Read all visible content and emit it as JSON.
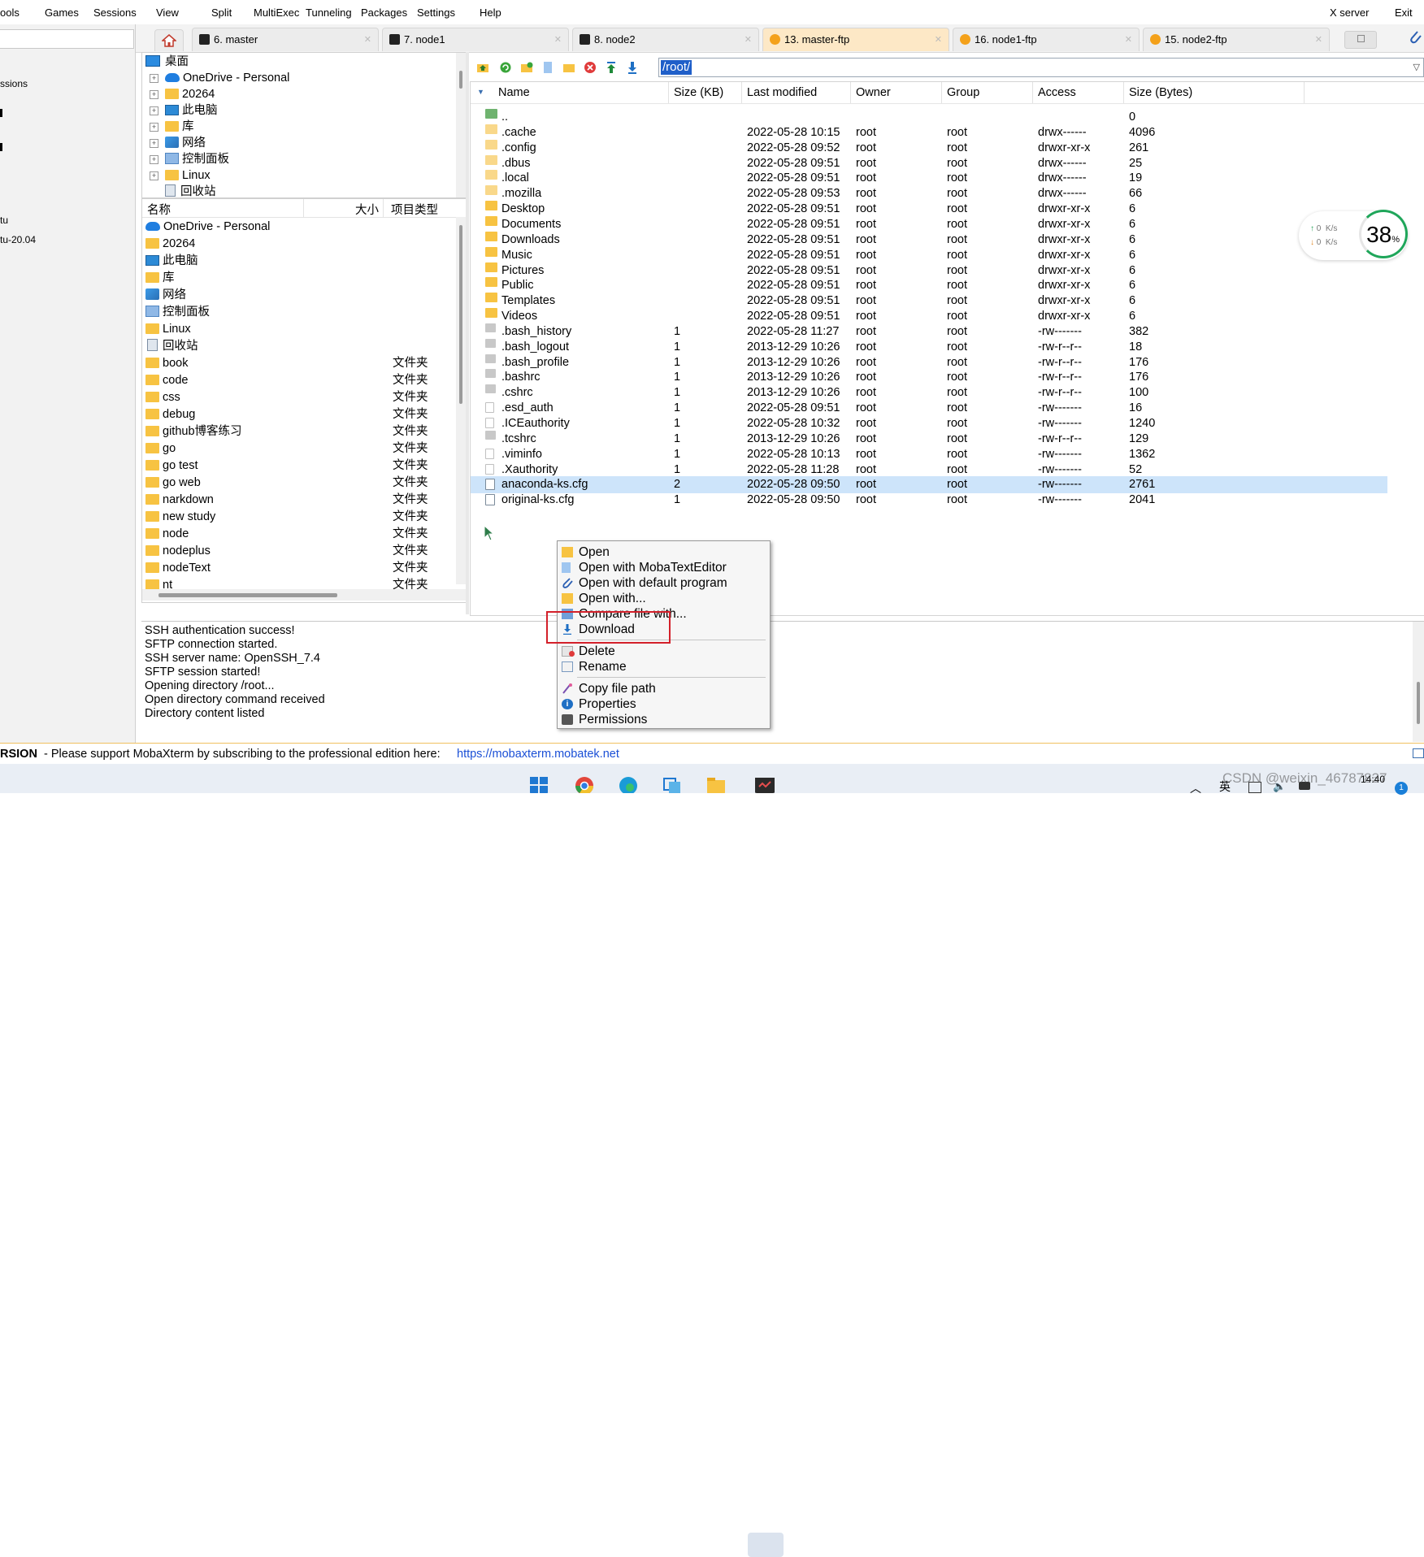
{
  "menubar": {
    "items": [
      "ools",
      "Games",
      "Sessions",
      "View",
      "Split",
      "MultiExec",
      "Tunneling",
      "Packages",
      "Settings",
      "Help"
    ],
    "xserver": "X server",
    "exit": "Exit"
  },
  "tabs": [
    {
      "label": "6. master",
      "kind": "terminal"
    },
    {
      "label": "7. node1",
      "kind": "terminal"
    },
    {
      "label": "8. node2",
      "kind": "terminal"
    },
    {
      "label": "13. master-ftp",
      "kind": "ftp",
      "active": true
    },
    {
      "label": "16. node1-ftp",
      "kind": "ftp"
    },
    {
      "label": "15. node2-ftp",
      "kind": "ftp"
    }
  ],
  "leftstrip": {
    "lines": [
      "ssions",
      "tu",
      "tu-20.04"
    ]
  },
  "local_tree": {
    "root": "桌面",
    "items": [
      "OneDrive - Personal",
      "20264",
      "此电脑",
      "库",
      "网络",
      "控制面板",
      "Linux",
      "回收站"
    ]
  },
  "local_list": {
    "headers": {
      "name": "名称",
      "size": "大小",
      "type": "项目类型"
    },
    "rows": [
      {
        "name": "OneDrive - Personal",
        "type": "",
        "icon": "onedrive-icon"
      },
      {
        "name": "20264",
        "type": "",
        "icon": "folder-icon"
      },
      {
        "name": "此电脑",
        "type": "",
        "icon": "computer-icon"
      },
      {
        "name": "库",
        "type": "",
        "icon": "folder-icon"
      },
      {
        "name": "网络",
        "type": "",
        "icon": "network-icon"
      },
      {
        "name": "控制面板",
        "type": "",
        "icon": "control-panel-icon"
      },
      {
        "name": "Linux",
        "type": "",
        "icon": "folder-icon"
      },
      {
        "name": "回收站",
        "type": "",
        "icon": "recycle-bin-icon"
      },
      {
        "name": "book",
        "type": "文件夹",
        "icon": "folder-icon"
      },
      {
        "name": "code",
        "type": "文件夹",
        "icon": "folder-icon"
      },
      {
        "name": "css",
        "type": "文件夹",
        "icon": "folder-icon"
      },
      {
        "name": "debug",
        "type": "文件夹",
        "icon": "folder-icon"
      },
      {
        "name": "github博客练习",
        "type": "文件夹",
        "icon": "folder-icon"
      },
      {
        "name": "go",
        "type": "文件夹",
        "icon": "folder-icon"
      },
      {
        "name": "go test",
        "type": "文件夹",
        "icon": "folder-icon"
      },
      {
        "name": "go web",
        "type": "文件夹",
        "icon": "folder-icon"
      },
      {
        "name": "narkdown",
        "type": "文件夹",
        "icon": "folder-icon"
      },
      {
        "name": "new study",
        "type": "文件夹",
        "icon": "folder-icon"
      },
      {
        "name": "node",
        "type": "文件夹",
        "icon": "folder-icon"
      },
      {
        "name": "nodeplus",
        "type": "文件夹",
        "icon": "folder-icon"
      },
      {
        "name": "nodeText",
        "type": "文件夹",
        "icon": "folder-icon"
      },
      {
        "name": "nt",
        "type": "文件夹",
        "icon": "folder-icon"
      }
    ]
  },
  "remote": {
    "path": "/root/",
    "headers": {
      "name": "Name",
      "size_kb": "Size (KB)",
      "modified": "Last modified",
      "owner": "Owner",
      "group": "Group",
      "access": "Access",
      "size_bytes": "Size (Bytes)"
    },
    "rows": [
      {
        "name": "..",
        "size_kb": "",
        "modified": "",
        "owner": "",
        "group": "",
        "access": "",
        "size_bytes": "0",
        "icon": "parent-dir-icon"
      },
      {
        "name": ".cache",
        "size_kb": "",
        "modified": "2022-05-28 10:15",
        "owner": "root",
        "group": "root",
        "access": "drwx------",
        "size_bytes": "4096",
        "icon": "hidden-folder-icon"
      },
      {
        "name": ".config",
        "size_kb": "",
        "modified": "2022-05-28 09:52",
        "owner": "root",
        "group": "root",
        "access": "drwxr-xr-x",
        "size_bytes": "261",
        "icon": "hidden-folder-icon"
      },
      {
        "name": ".dbus",
        "size_kb": "",
        "modified": "2022-05-28 09:51",
        "owner": "root",
        "group": "root",
        "access": "drwx------",
        "size_bytes": "25",
        "icon": "hidden-folder-icon"
      },
      {
        "name": ".local",
        "size_kb": "",
        "modified": "2022-05-28 09:51",
        "owner": "root",
        "group": "root",
        "access": "drwx------",
        "size_bytes": "19",
        "icon": "hidden-folder-icon"
      },
      {
        "name": ".mozilla",
        "size_kb": "",
        "modified": "2022-05-28 09:53",
        "owner": "root",
        "group": "root",
        "access": "drwx------",
        "size_bytes": "66",
        "icon": "hidden-folder-icon"
      },
      {
        "name": "Desktop",
        "size_kb": "",
        "modified": "2022-05-28 09:51",
        "owner": "root",
        "group": "root",
        "access": "drwxr-xr-x",
        "size_bytes": "6",
        "icon": "folder-icon"
      },
      {
        "name": "Documents",
        "size_kb": "",
        "modified": "2022-05-28 09:51",
        "owner": "root",
        "group": "root",
        "access": "drwxr-xr-x",
        "size_bytes": "6",
        "icon": "folder-icon"
      },
      {
        "name": "Downloads",
        "size_kb": "",
        "modified": "2022-05-28 09:51",
        "owner": "root",
        "group": "root",
        "access": "drwxr-xr-x",
        "size_bytes": "6",
        "icon": "folder-icon"
      },
      {
        "name": "Music",
        "size_kb": "",
        "modified": "2022-05-28 09:51",
        "owner": "root",
        "group": "root",
        "access": "drwxr-xr-x",
        "size_bytes": "6",
        "icon": "folder-icon"
      },
      {
        "name": "Pictures",
        "size_kb": "",
        "modified": "2022-05-28 09:51",
        "owner": "root",
        "group": "root",
        "access": "drwxr-xr-x",
        "size_bytes": "6",
        "icon": "folder-icon"
      },
      {
        "name": "Public",
        "size_kb": "",
        "modified": "2022-05-28 09:51",
        "owner": "root",
        "group": "root",
        "access": "drwxr-xr-x",
        "size_bytes": "6",
        "icon": "folder-icon"
      },
      {
        "name": "Templates",
        "size_kb": "",
        "modified": "2022-05-28 09:51",
        "owner": "root",
        "group": "root",
        "access": "drwxr-xr-x",
        "size_bytes": "6",
        "icon": "folder-icon"
      },
      {
        "name": "Videos",
        "size_kb": "",
        "modified": "2022-05-28 09:51",
        "owner": "root",
        "group": "root",
        "access": "drwxr-xr-x",
        "size_bytes": "6",
        "icon": "folder-icon"
      },
      {
        "name": ".bash_history",
        "size_kb": "1",
        "modified": "2022-05-28 11:27",
        "owner": "root",
        "group": "root",
        "access": "-rw-------",
        "size_bytes": "382",
        "icon": "file-icon"
      },
      {
        "name": ".bash_logout",
        "size_kb": "1",
        "modified": "2013-12-29 10:26",
        "owner": "root",
        "group": "root",
        "access": "-rw-r--r--",
        "size_bytes": "18",
        "icon": "file-icon"
      },
      {
        "name": ".bash_profile",
        "size_kb": "1",
        "modified": "2013-12-29 10:26",
        "owner": "root",
        "group": "root",
        "access": "-rw-r--r--",
        "size_bytes": "176",
        "icon": "file-icon"
      },
      {
        "name": ".bashrc",
        "size_kb": "1",
        "modified": "2013-12-29 10:26",
        "owner": "root",
        "group": "root",
        "access": "-rw-r--r--",
        "size_bytes": "176",
        "icon": "file-icon"
      },
      {
        "name": ".cshrc",
        "size_kb": "1",
        "modified": "2013-12-29 10:26",
        "owner": "root",
        "group": "root",
        "access": "-rw-r--r--",
        "size_bytes": "100",
        "icon": "file-icon"
      },
      {
        "name": ".esd_auth",
        "size_kb": "1",
        "modified": "2022-05-28 09:51",
        "owner": "root",
        "group": "root",
        "access": "-rw-------",
        "size_bytes": "16",
        "icon": "blank-file-icon"
      },
      {
        "name": ".ICEauthority",
        "size_kb": "1",
        "modified": "2022-05-28 10:32",
        "owner": "root",
        "group": "root",
        "access": "-rw-------",
        "size_bytes": "1240",
        "icon": "blank-file-icon"
      },
      {
        "name": ".tcshrc",
        "size_kb": "1",
        "modified": "2013-12-29 10:26",
        "owner": "root",
        "group": "root",
        "access": "-rw-r--r--",
        "size_bytes": "129",
        "icon": "file-icon"
      },
      {
        "name": ".viminfo",
        "size_kb": "1",
        "modified": "2022-05-28 10:13",
        "owner": "root",
        "group": "root",
        "access": "-rw-------",
        "size_bytes": "1362",
        "icon": "blank-file-icon"
      },
      {
        "name": ".Xauthority",
        "size_kb": "1",
        "modified": "2022-05-28 11:28",
        "owner": "root",
        "group": "root",
        "access": "-rw-------",
        "size_bytes": "52",
        "icon": "blank-file-icon"
      },
      {
        "name": "anaconda-ks.cfg",
        "size_kb": "2",
        "modified": "2022-05-28 09:50",
        "owner": "root",
        "group": "root",
        "access": "-rw-------",
        "size_bytes": "2761",
        "icon": "cfg-file-icon",
        "selected": true
      },
      {
        "name": "original-ks.cfg",
        "size_kb": "1",
        "modified": "2022-05-28 09:50",
        "owner": "root",
        "group": "root",
        "access": "-rw-------",
        "size_bytes": "2041",
        "icon": "cfg-file-icon"
      }
    ]
  },
  "context_menu": {
    "items": [
      {
        "label": "Open",
        "icon": "folder-icon"
      },
      {
        "label": "Open with MobaTextEditor",
        "icon": "text-editor-icon"
      },
      {
        "label": "Open with default program",
        "icon": "paperclip-icon"
      },
      {
        "label": "Open with...",
        "icon": "open-with-icon"
      },
      {
        "label": "Compare file with...",
        "icon": "compare-icon"
      },
      {
        "label": "Download",
        "icon": "download-icon"
      },
      {
        "label": "Delete",
        "icon": "delete-icon"
      },
      {
        "label": "Rename",
        "icon": "rename-icon"
      },
      {
        "label": "Copy file path",
        "icon": "copy-path-icon"
      },
      {
        "label": "Properties",
        "icon": "info-icon"
      },
      {
        "label": "Permissions",
        "icon": "permissions-icon"
      }
    ]
  },
  "log": [
    "SSH authentication success!",
    "SFTP connection started.",
    "SSH server name: OpenSSH_7.4",
    "SFTP session started!",
    "Opening directory /root...",
    "Open directory command received",
    "Directory content listed"
  ],
  "statusbar": {
    "edition": "RSION",
    "message": "-  Please support MobaXterm by subscribing to the professional edition here:",
    "link": "https://mobaxterm.mobatek.net"
  },
  "speed_widget": {
    "up": "0",
    "down": "0",
    "unit": "K/s",
    "percent": "38",
    "percent_sign": "%"
  },
  "taskbar": {
    "ime": "英",
    "time": "14:40",
    "watermark": "CSDN @weixin_46787837",
    "notif_count": "1"
  },
  "colors": {
    "active_tab": "#fde8c6",
    "selection": "#cde4fa",
    "path_highlight": "#1f5fc9",
    "annotation_red": "#d3202a",
    "folder": "#f7c342",
    "link": "#1a4fd6"
  }
}
